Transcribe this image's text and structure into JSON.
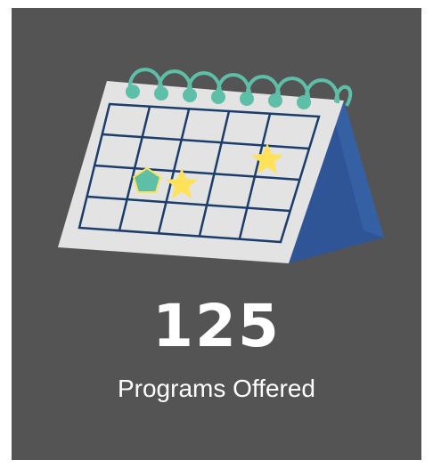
{
  "stat": {
    "number": "125",
    "label": "Programs Offered"
  },
  "icon": "desk-calendar-icon",
  "colors": {
    "background": "#545454",
    "calendar_page": "#e3e3e3",
    "grid_lines": "#1b3d6b",
    "stand": "#2f5596",
    "rings": "#5ebfa8",
    "stars": "#ffe259",
    "text": "#ffffff"
  }
}
